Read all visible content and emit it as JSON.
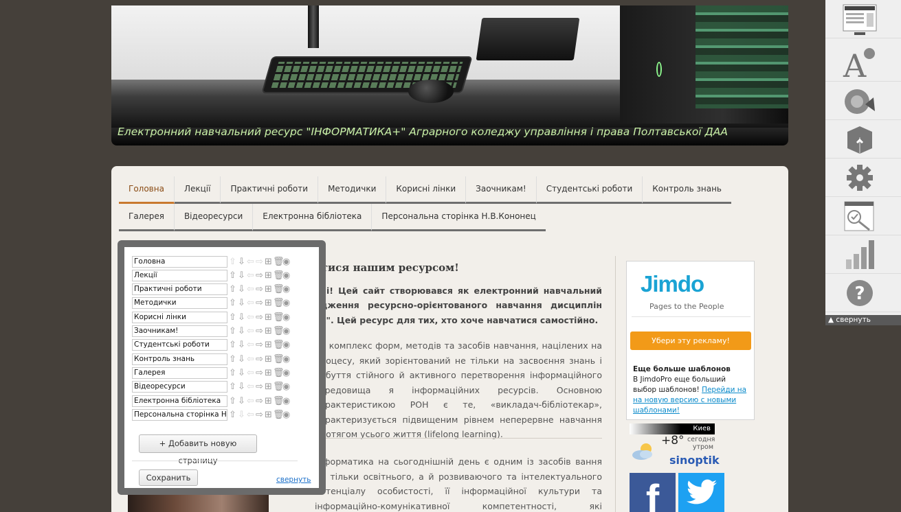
{
  "header": {
    "title": "Електронний навчальний ресурс \"ІНФОРМАТИКА+\" Аграрного коледжу управління і права Полтавської ДАА"
  },
  "nav": {
    "row1": [
      "Головна",
      "Лекції",
      "Практичні роботи",
      "Методички",
      "Корисні лінки",
      "Заочникам!",
      "Студентські роботи",
      "Контроль знань"
    ],
    "row2": [
      "Галерея",
      "Відеоресурси",
      "Електронна бібліотека",
      "Персональна сторінка Н.В.Кононец"
    ],
    "active": "Головна"
  },
  "main": {
    "heading": "атися нашим ресурсом!",
    "lead": "ачі! Цей сайт створювався як електронний навчальний адження ресурсно-орієнтованого навчання дисциплін ах\". Цей ресурс для тих, хто хоче навчатися самостійно.",
    "para1": "це комплекс форм, методів та засобів навчання, націлених на процесу, який зорієнтований не тільки на засвоєння знань і набуття стійного й активного перетворення інформаційного середовища я інформаційних ресурсів. Основною характеристикою РОН є те, «викладач-бібліотекар», характеризується підвищеним рівнем неперервне навчання протягом усього життя (lifelong learning).",
    "para2": "Інформатика на сьогоднішній день є одним із засобів вання не тільки освітнього, а й розвиваючого та інтелектуального потенціалу особистості, її інформаційної культури та інформаційно-комунікативної компетентності, які проявляються: у знанні аналітичних"
  },
  "editor": {
    "pages": [
      "Головна",
      "Лекції",
      "Практичні роботи",
      "Методички",
      "Корисні лінки",
      "Заочникам!",
      "Студентські роботи",
      "Контроль знань",
      "Галерея",
      "Відеоресурси",
      "Електронна бібліотека",
      "Персональна сторінка Н.В"
    ],
    "add_label": "+ Добавить новую страницу",
    "save_label": "Сохранить",
    "collapse_label": "свернуть"
  },
  "sidebar": {
    "jimdo": {
      "logo": "Jimdo",
      "tagline": "Pages to the People",
      "remove_ad_label": "Убери эту рекламу!",
      "promo_title": "Еще больше шаблонов",
      "promo_text": "В JimdoPro еще больший выбор шаблонов!",
      "promo_link": "Перейди на на новую версию с новыми шаблонами!"
    },
    "weather": {
      "city": "Киев",
      "temp": "+8°",
      "desc_line1": "сегодня",
      "desc_line2": "утром",
      "brand": "sinoptik"
    },
    "social": {
      "facebook": "f"
    }
  },
  "toolbar": {
    "items": [
      "layout-icon",
      "font-style-icon",
      "sound-icon",
      "package-icon",
      "settings-gear-icon",
      "seo-check-icon",
      "statistics-icon",
      "help-icon"
    ],
    "collapse_label": "свернуть"
  }
}
